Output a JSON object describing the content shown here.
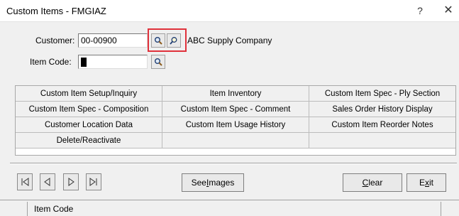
{
  "window": {
    "title": "Custom Items - FMGIAZ",
    "help_label": "?",
    "close_label": "✕"
  },
  "form": {
    "customer_label": "Customer:",
    "customer_value": "00-00900",
    "company_name": "ABC Supply Company",
    "item_code_label": "Item Code:",
    "item_code_value": ""
  },
  "icons": {
    "lookup": "magnifier-icon",
    "lookup_alt": "magnifier-zoom-icon"
  },
  "menu": {
    "items": [
      "Custom Item Setup/Inquiry",
      "Item Inventory",
      "Custom Item Spec - Ply Section",
      "Custom Item Spec - Composition",
      "Custom Item Spec - Comment",
      "Sales Order History Display",
      "Customer Location Data",
      "Custom Item Usage History",
      "Custom Item Reorder Notes",
      "Delete/Reactivate",
      "",
      ""
    ]
  },
  "toolbar": {
    "see_images": {
      "pre": "See ",
      "accel": "I",
      "post": "mages"
    },
    "clear": {
      "pre": "",
      "accel": "C",
      "post": "lear"
    },
    "exit": {
      "pre": "E",
      "accel": "x",
      "post": "it"
    }
  },
  "status": {
    "text": "Item Code"
  },
  "colors": {
    "highlight_box": "#e0313b",
    "window_bg": "#f0f0f0"
  }
}
